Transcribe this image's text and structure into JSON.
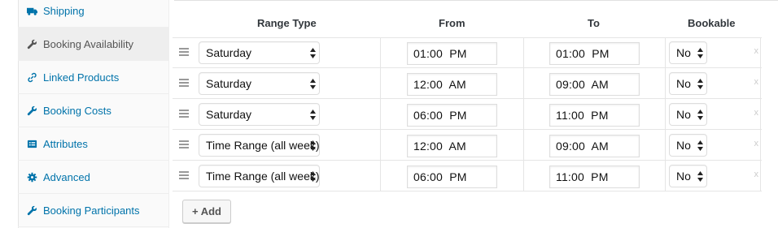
{
  "sidebar": {
    "items": [
      {
        "label": "Shipping",
        "icon": "truck-icon"
      },
      {
        "label": "Booking Availability",
        "icon": "wrench-icon",
        "active": true
      },
      {
        "label": "Linked Products",
        "icon": "link-icon"
      },
      {
        "label": "Booking Costs",
        "icon": "wrench-icon"
      },
      {
        "label": "Attributes",
        "icon": "list-table-icon"
      },
      {
        "label": "Advanced",
        "icon": "gear-icon"
      },
      {
        "label": "Booking Participants",
        "icon": "wrench-icon"
      }
    ]
  },
  "table": {
    "headers": {
      "range_type": "Range Type",
      "from": "From",
      "to": "To",
      "bookable": "Bookable"
    },
    "rows": [
      {
        "range_type": "Saturday",
        "from": "01:00  PM",
        "to": "01:00  PM",
        "bookable": "No",
        "remove": "x"
      },
      {
        "range_type": "Saturday",
        "from": "12:00  AM",
        "to": "09:00  AM",
        "bookable": "No",
        "remove": "x"
      },
      {
        "range_type": "Saturday",
        "from": "06:00  PM",
        "to": "11:00  PM",
        "bookable": "No",
        "remove": "x"
      },
      {
        "range_type": "Time Range (all week)",
        "from": "12:00  AM",
        "to": "09:00  AM",
        "bookable": "No",
        "remove": "x"
      },
      {
        "range_type": "Time Range (all week)",
        "from": "06:00  PM",
        "to": "11:00  PM",
        "bookable": "No",
        "remove": "x"
      }
    ]
  },
  "add_button": {
    "label": "+ Add"
  },
  "colors": {
    "link": "#0073aa",
    "active_tab_bg": "#eeeeee",
    "border": "#e5e5e5"
  }
}
